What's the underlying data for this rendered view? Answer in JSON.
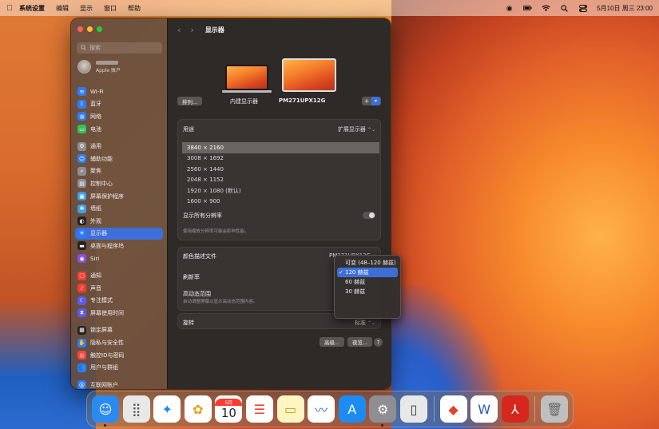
{
  "menubar": {
    "app_name": "系统设置",
    "menus": [
      "编辑",
      "显示",
      "窗口",
      "帮助"
    ],
    "datetime": "5月10日 周三 23:00"
  },
  "sidebar": {
    "search_placeholder": "搜索",
    "account_sub": "Apple 账户",
    "items": [
      {
        "label": "Wi-Fi",
        "icon": "wifi-icon",
        "color": "#2d7cf6"
      },
      {
        "label": "蓝牙",
        "icon": "bluetooth-icon",
        "color": "#2d7cf6"
      },
      {
        "label": "网络",
        "icon": "globe-icon",
        "color": "#2d7cf6"
      },
      {
        "label": "电池",
        "icon": "battery-icon",
        "color": "#32c25a"
      },
      {
        "label": "通用",
        "icon": "gear-icon",
        "color": "#8e8e93"
      },
      {
        "label": "辅助功能",
        "icon": "accessibility-icon",
        "color": "#2d7cf6"
      },
      {
        "label": "聚焦",
        "icon": "spotlight-icon",
        "color": "#8e8e93"
      },
      {
        "label": "控制中心",
        "icon": "control-center-icon",
        "color": "#8e8e93"
      },
      {
        "label": "屏幕保护程序",
        "icon": "screensaver-icon",
        "color": "#3aa0e8"
      },
      {
        "label": "墙纸",
        "icon": "wallpaper-icon",
        "color": "#3aa0e8"
      },
      {
        "label": "外观",
        "icon": "appearance-icon",
        "color": "#222222"
      },
      {
        "label": "显示器",
        "icon": "display-icon",
        "color": "#2d7cf6"
      },
      {
        "label": "桌面与程序坞",
        "icon": "dock-icon",
        "color": "#222222"
      },
      {
        "label": "Siri",
        "icon": "siri-icon",
        "color": "#8a4de0"
      },
      {
        "label": "通知",
        "icon": "notification-icon",
        "color": "#ff3b30"
      },
      {
        "label": "声音",
        "icon": "sound-icon",
        "color": "#ff3b30"
      },
      {
        "label": "专注模式",
        "icon": "focus-icon",
        "color": "#5e5ce6"
      },
      {
        "label": "屏幕使用时间",
        "icon": "screen-time-icon",
        "color": "#5e5ce6"
      },
      {
        "label": "锁定屏幕",
        "icon": "lock-screen-icon",
        "color": "#222222"
      },
      {
        "label": "隐私与安全性",
        "icon": "privacy-icon",
        "color": "#2d7cf6"
      },
      {
        "label": "触控ID与密码",
        "icon": "touchid-icon",
        "color": "#ff453a"
      },
      {
        "label": "用户与群组",
        "icon": "users-icon",
        "color": "#2d7cf6"
      },
      {
        "label": "互联网账户",
        "icon": "internet-accounts-icon",
        "color": "#2d7cf6"
      }
    ]
  },
  "main": {
    "title": "显示器",
    "arrange_label": "排列...",
    "display1_label": "内建显示器",
    "display2_label": "PM271UPX12G",
    "use_as_label": "用途",
    "use_as_value": "扩展显示器",
    "resolutions": [
      "3840 × 2160",
      "3008 × 1692",
      "2560 × 1440",
      "2048 × 1152",
      "1920 × 1080 (默认)",
      "1600 × 900"
    ],
    "selected_resolution_index": 0,
    "show_all_label": "显示所有分辨率",
    "resolution_hint": "使用缩放分辨率可能会影响性能。",
    "color_profile_label": "颜色描述文件",
    "color_profile_value": "PM271UPX12G",
    "refresh_label": "刷新率",
    "hdr_label": "高动态范围",
    "hdr_hint": "自动调整屏幕以显示高动态范围内容。",
    "rotation_label": "旋转",
    "rotation_value": "标准",
    "advanced_button": "高级...",
    "night_shift_button": "夜览...",
    "help_button": "?"
  },
  "refresh_popup": {
    "options": [
      "可变 (48–120 赫兹)",
      "120 赫兹",
      "60 赫兹",
      "30 赫兹"
    ],
    "selected_index": 1
  },
  "dock": {
    "calendar_month": "5月",
    "calendar_day": "10",
    "apps": [
      {
        "name": "finder-icon",
        "color": "#2b8af0"
      },
      {
        "name": "launchpad-icon",
        "color": "#e8e8e8"
      },
      {
        "name": "safari-icon",
        "color": "#ffffff"
      },
      {
        "name": "photos-icon",
        "color": "#ffffff"
      },
      {
        "name": "calendar-icon",
        "color": "#ffffff"
      },
      {
        "name": "reminders-icon",
        "color": "#ffffff"
      },
      {
        "name": "notes-icon",
        "color": "#fff5c2"
      },
      {
        "name": "freeform-icon",
        "color": "#ffffff"
      },
      {
        "name": "app-store-icon",
        "color": "#1d8bf1"
      },
      {
        "name": "system-settings-icon",
        "color": "#8e8e93"
      },
      {
        "name": "iphone-mirroring-icon",
        "color": "#e8e8e8"
      },
      {
        "name": "pdf-app-icon",
        "color": "#ffffff"
      },
      {
        "name": "word-icon",
        "color": "#ffffff"
      },
      {
        "name": "acrobat-icon",
        "color": "#d6261d"
      },
      {
        "name": "trash-icon",
        "color": "#bfbfbf"
      }
    ]
  }
}
